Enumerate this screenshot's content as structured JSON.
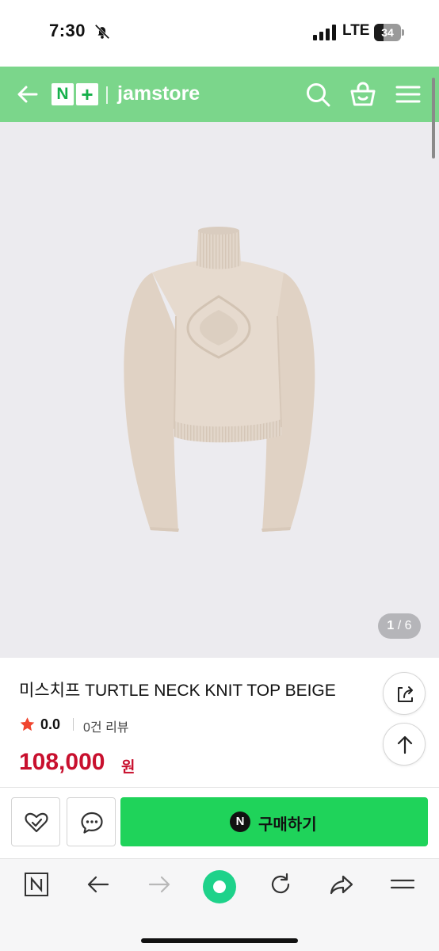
{
  "status_bar": {
    "time": "7:30",
    "network": "LTE",
    "battery_level": "34",
    "battery_fraction": 0.34
  },
  "header": {
    "logo_n": "N",
    "logo_plus": "+",
    "store_name": "jamstore",
    "color": "#7bd68b"
  },
  "gallery": {
    "current": "1",
    "separator": " / ",
    "total": "6"
  },
  "product": {
    "title": "미스치프 TURTLE NECK KNIT TOP BEIGE",
    "rating": "0.0",
    "review_count": "0건 리뷰",
    "price": "108,000",
    "currency": "원",
    "price_color": "#c8102e"
  },
  "buy_bar": {
    "badge": "N",
    "buy_label": "구매하기",
    "accent": "#1fd35a"
  },
  "icons": {
    "back": "arrow-left-icon",
    "search": "search-icon",
    "cart": "basket-icon",
    "menu": "hamburger-icon",
    "share": "share-icon",
    "top": "arrow-up-icon",
    "wish": "heart-check-icon",
    "talk": "chat-bubble-icon"
  }
}
